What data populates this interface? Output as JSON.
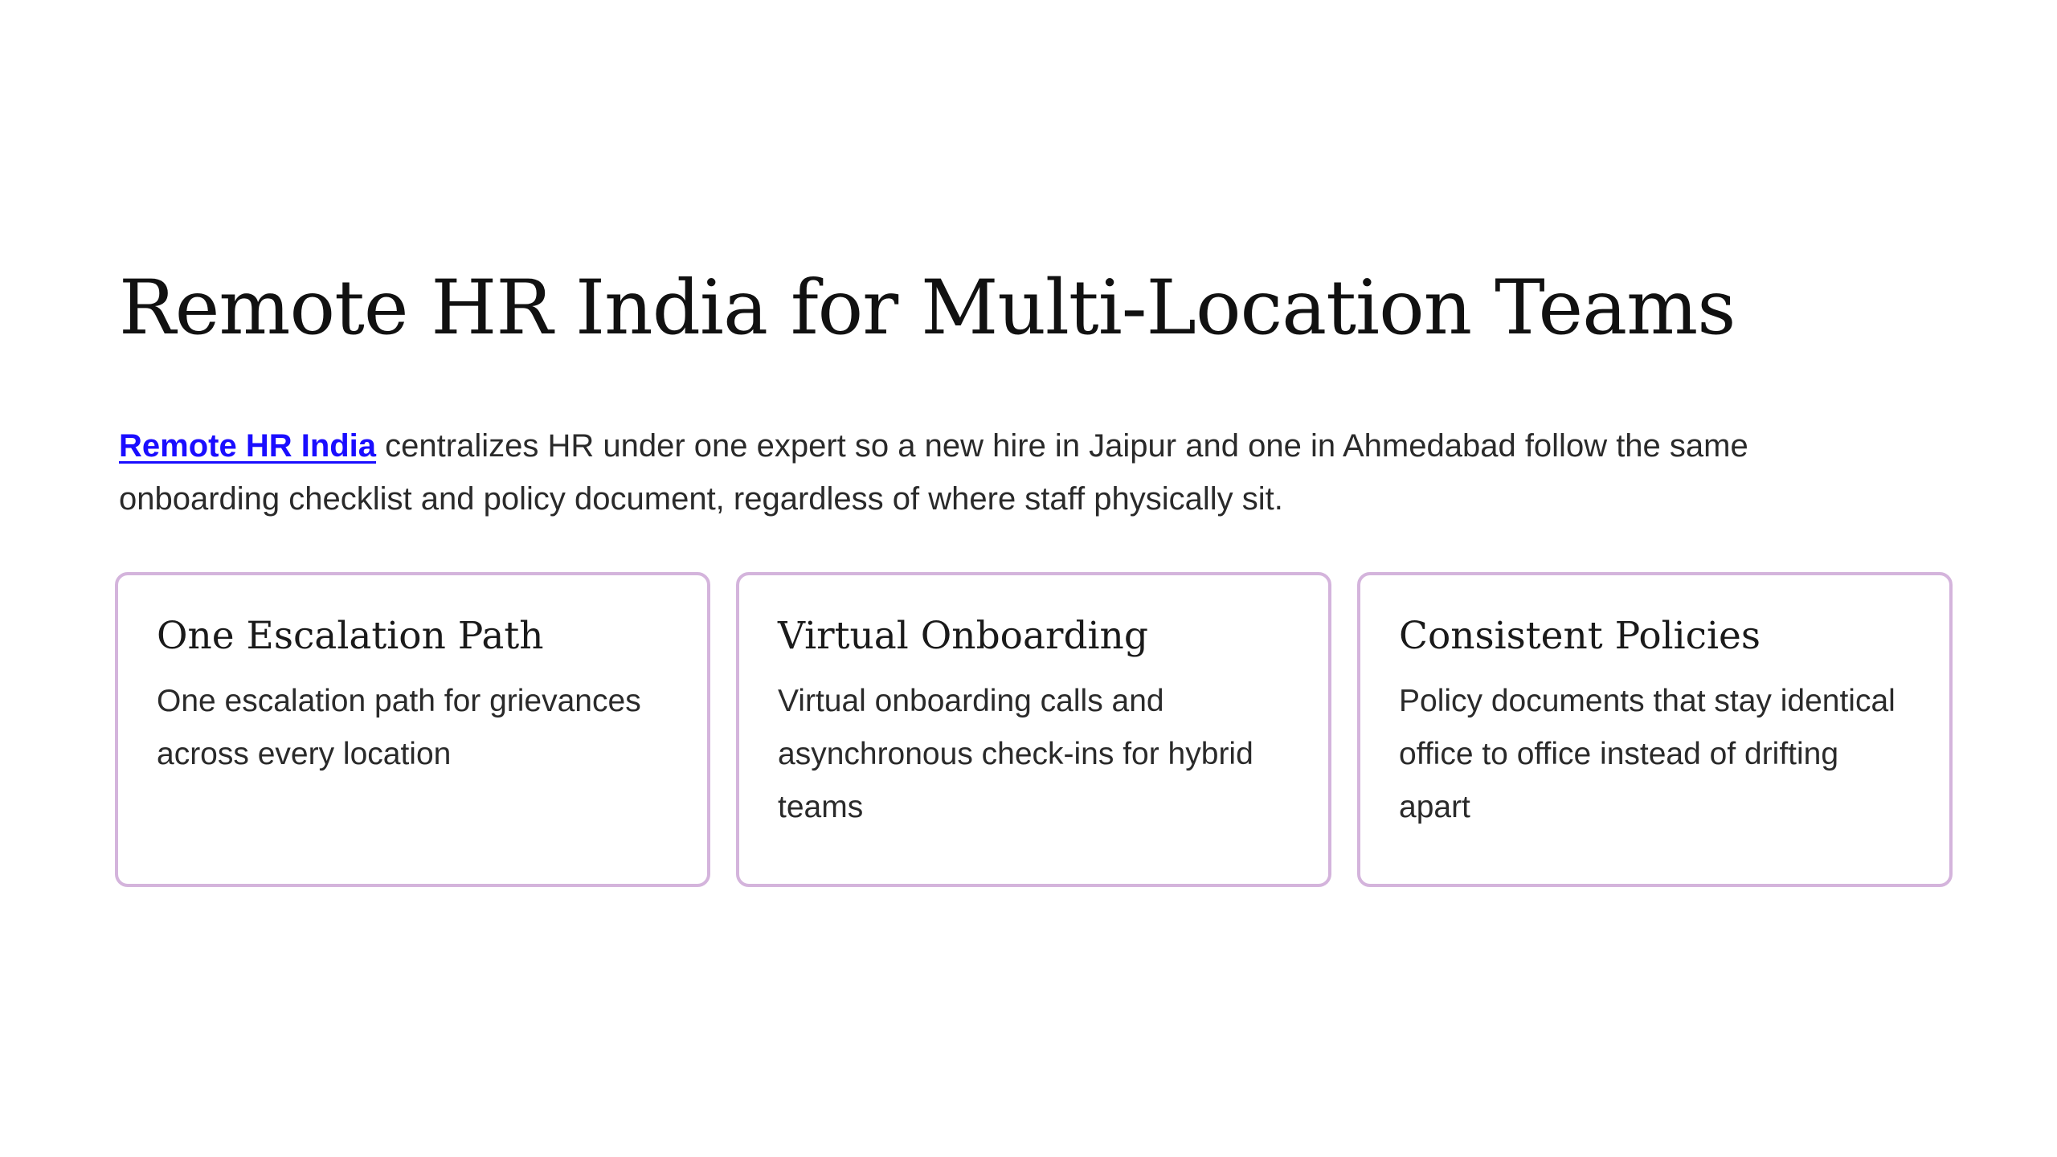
{
  "heading": "Remote HR India for Multi-Location Teams",
  "intro": {
    "link_text": "Remote HR India",
    "text": " centralizes HR under one expert so a new hire in Jaipur and one in Ahmedabad follow the same onboarding checklist and policy document, regardless of where staff physically sit."
  },
  "cards": [
    {
      "title": "One Escalation Path",
      "text": "One escalation path for grievances across every location"
    },
    {
      "title": "Virtual Onboarding",
      "text": "Virtual onboarding calls and asynchronous check-ins for hybrid teams"
    },
    {
      "title": "Consistent Policies",
      "text": "Policy documents that stay identical office to office instead of drifting apart"
    }
  ],
  "colors": {
    "link": "#1a0dff",
    "card_border": "#d4b4dc",
    "text": "#2a2a2a"
  }
}
